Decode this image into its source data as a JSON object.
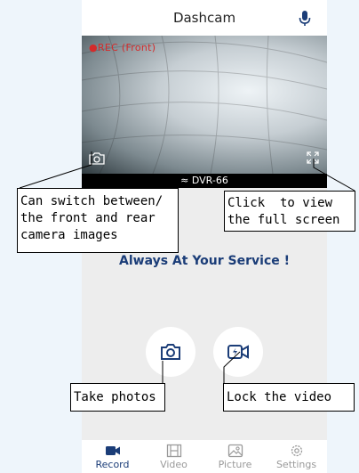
{
  "header": {
    "title": "Dashcam",
    "mic_icon": "mic-icon"
  },
  "camera": {
    "rec_label": "●REC",
    "rec_source": "(Front)",
    "switch_icon": "camera-switch-icon",
    "fullscreen_icon": "fullscreen-icon"
  },
  "status": {
    "wifi_icon": "wifi-icon",
    "ssid": "DVR-66"
  },
  "main": {
    "slogan": "Always At Your Service !"
  },
  "actions": {
    "photo_icon": "camera-icon",
    "lock_icon": "lock-video-icon"
  },
  "tabs": [
    {
      "label": "Record",
      "icon": "record-icon",
      "active": true
    },
    {
      "label": "Video",
      "icon": "film-icon",
      "active": false
    },
    {
      "label": "Picture",
      "icon": "image-icon",
      "active": false
    },
    {
      "label": "Settings",
      "icon": "gear-icon",
      "active": false
    }
  ],
  "annotations": {
    "switch_line1": "Can switch between/",
    "switch_line2": "the front and rear",
    "switch_line3": "camera images",
    "fullscreen_line1": "Click  to view",
    "fullscreen_line2": "the full screen",
    "photo": "Take photos",
    "lock": "Lock the video"
  },
  "colors": {
    "accent": "#1b3d78",
    "rec_red": "#d42b2b",
    "background": "#ededed",
    "outer": "#eef5fb"
  }
}
